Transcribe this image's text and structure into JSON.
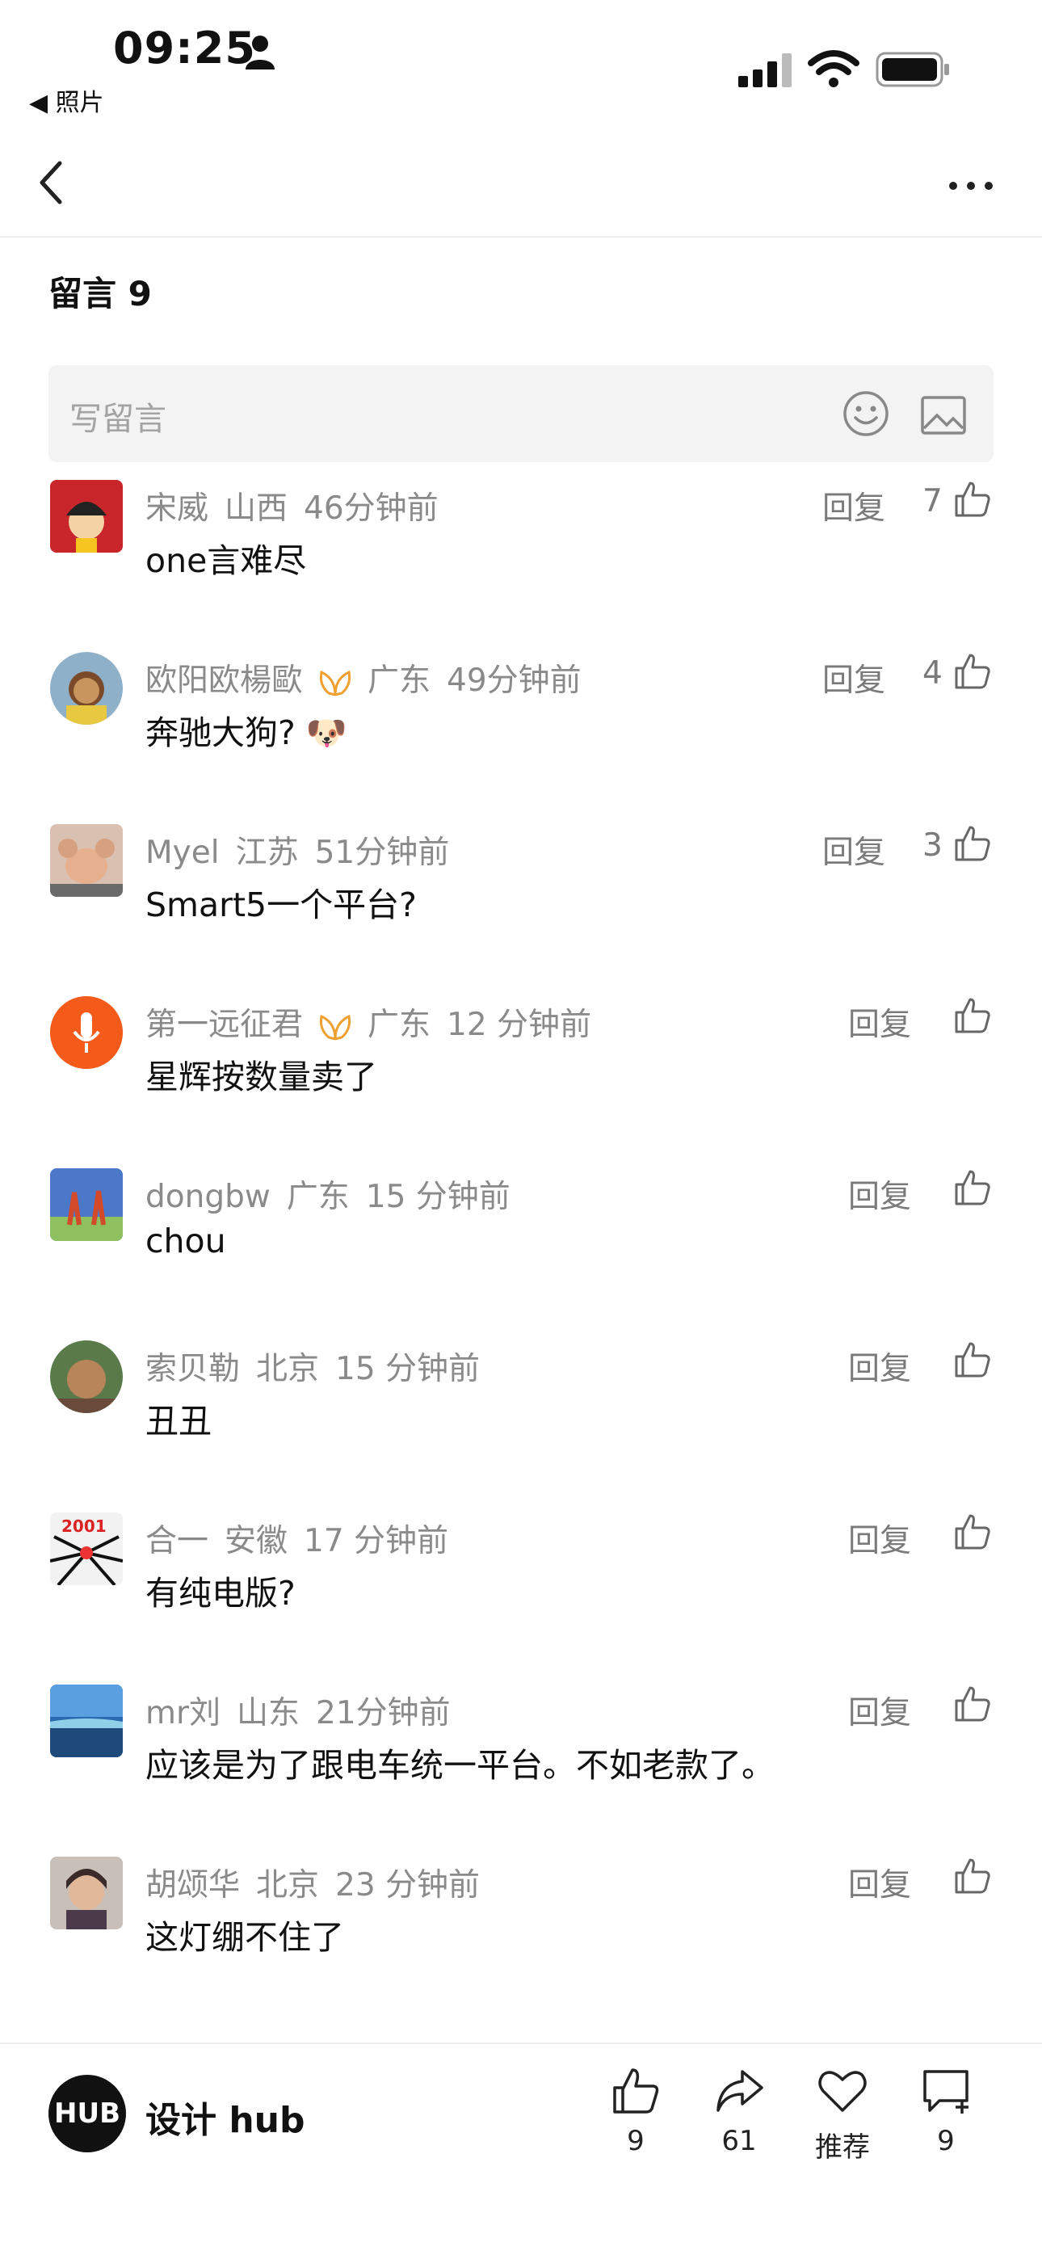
{
  "status_bar": {
    "time": "09:25",
    "back_app": "◀ 照片"
  },
  "header": {
    "title": "留言 9"
  },
  "input": {
    "placeholder": "写留言"
  },
  "reply_label": "回复",
  "comments": [
    {
      "user": "宋威",
      "region": "山西",
      "time": "46分钟前",
      "text": "one言难尽",
      "likes": "7",
      "vip": false
    },
    {
      "user": "欧阳欧楊歐",
      "region": "广东",
      "time": "49分钟前",
      "text": "奔驰大狗? 🐶",
      "likes": "4",
      "vip": true
    },
    {
      "user": "Myel",
      "region": "江苏",
      "time": "51分钟前",
      "text": "Smart5一个平台?",
      "likes": "3",
      "vip": false
    },
    {
      "user": "第一远征君",
      "region": "广东",
      "time": "12 分钟前",
      "text": "星辉按数量卖了",
      "likes": "",
      "vip": true
    },
    {
      "user": "dongbw",
      "region": "广东",
      "time": "15 分钟前",
      "text": "chou",
      "likes": "",
      "vip": false
    },
    {
      "user": "索贝勒",
      "region": "北京",
      "time": "15 分钟前",
      "text": "丑丑",
      "likes": "",
      "vip": false
    },
    {
      "user": "合一",
      "region": "安徽",
      "time": "17 分钟前",
      "text": "有纯电版?",
      "likes": "",
      "vip": false
    },
    {
      "user": "mr刘",
      "region": "山东",
      "time": "21分钟前",
      "text": "应该是为了跟电车统一平台。不如老款了。",
      "likes": "",
      "vip": false
    },
    {
      "user": "胡颂华",
      "region": "北京",
      "time": "23 分钟前",
      "text": "这灯绷不住了",
      "likes": "",
      "vip": false
    }
  ],
  "bottom_bar": {
    "account_logo": "HUB",
    "account_name": "设计 hub",
    "like_count": "9",
    "share_count": "61",
    "recommend_label": "推荐",
    "comment_count": "9"
  },
  "colors": {
    "vip": "#f0a030",
    "text_secondary": "#8a8a8a"
  }
}
